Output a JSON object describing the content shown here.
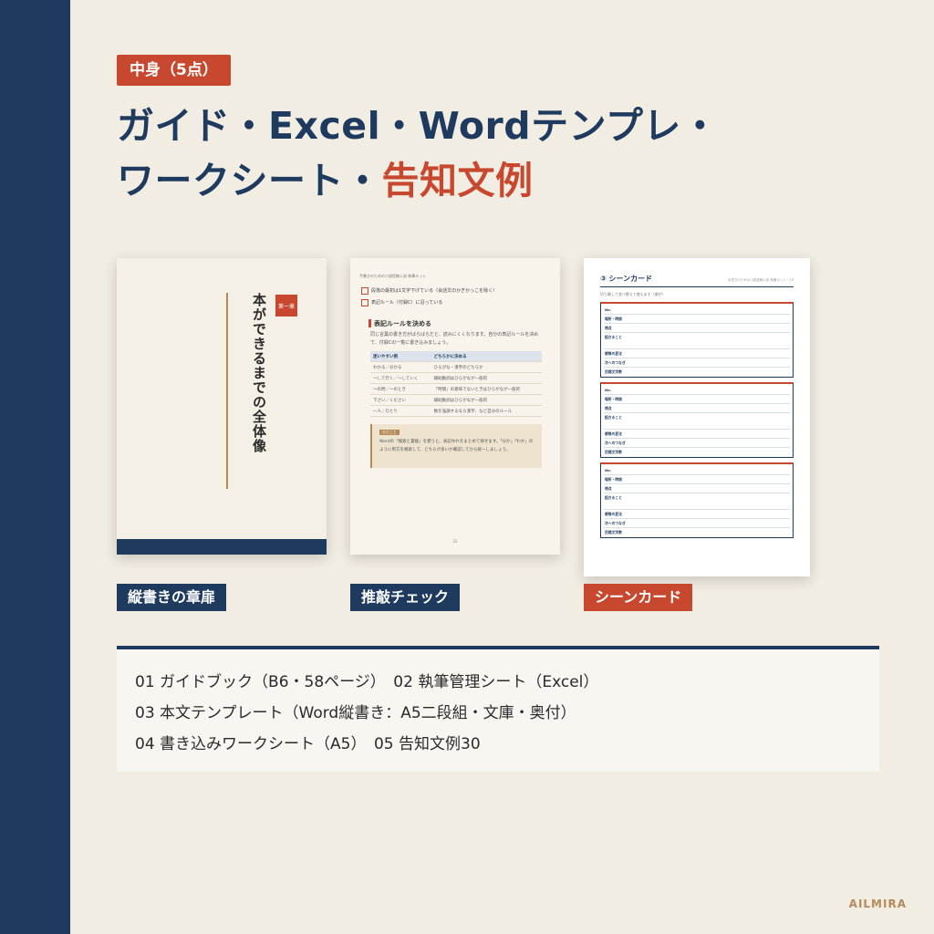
{
  "badge": "中身（5点）",
  "headline": {
    "line1": "ガイド・Excel・Wordテンプレ・",
    "line2_prefix": "ワークシート・",
    "line2_accent": "告知文例"
  },
  "colors": {
    "navy": "#1e3a5f",
    "accent_red": "#c8482f",
    "background": "#f2ede3",
    "gold": "#b58a5a"
  },
  "cards": {
    "chapter": {
      "title": "本ができるまでの全体像",
      "caption": "縦書きの章扉"
    },
    "check": {
      "header": "手書きのための小説投稿入試 執筆キット",
      "checks": [
        "段落の最初は1文字下げている（会話文のかぎかっこを除く）",
        "表記ルール（付録C）に沿っている"
      ],
      "section": "表記ルールを決める",
      "para": "同じ言葉の書き方がばらばらだと、読みにくくなります。自分の表記ルールを決めて、付録Cの一覧に書き込みましょう。",
      "table": {
        "headers": [
          "迷いやすい例",
          "どちらかに決める"
        ],
        "rows": [
          [
            "わかる／分かる",
            "ひらがな・漢字のどちらか"
          ],
          [
            "〜して行く／〜していく",
            "補助動詞はひらがなが一般的"
          ],
          [
            "〜の時／〜のとき",
            "「時間」の意味でないときはひらがなが一般的"
          ],
          [
            "下さい／ください",
            "補助動詞はひらがなが一般的"
          ],
          [
            "一人／ひとり",
            "数を強調するなら漢字、など自分のルール"
          ]
        ]
      },
      "note_tag": "ひとこと",
      "note": "Wordの「検索と置換」を使うと、表記ゆれをまとめて探せます。「分か」「わか」のように両方を検索して、どちらが多いか確認してから統一しましょう。",
      "page": "22",
      "caption": "推敲チェック"
    },
    "scene": {
      "title": "③ シーンカード",
      "meta": "手書きのための小説投稿入試 執筆キット｜16",
      "sub": "切り離して並べ替えて使えます（順が）",
      "labels": [
        "No.",
        "場所・時間",
        "視点",
        "起きること",
        "感情の変化",
        "次へのつなぎ",
        "目標文字数"
      ],
      "caption": "シーンカード"
    }
  },
  "contents": {
    "line1": "01 ガイドブック（B6・58ページ）　02 執筆管理シート（Excel）",
    "line2": "03 本文テンプレート（Word縦書き：A5二段組・文庫・奥付）",
    "line3": "04 書き込みワークシート（A5）　05 告知文例30"
  },
  "brand": "AILMIRA"
}
